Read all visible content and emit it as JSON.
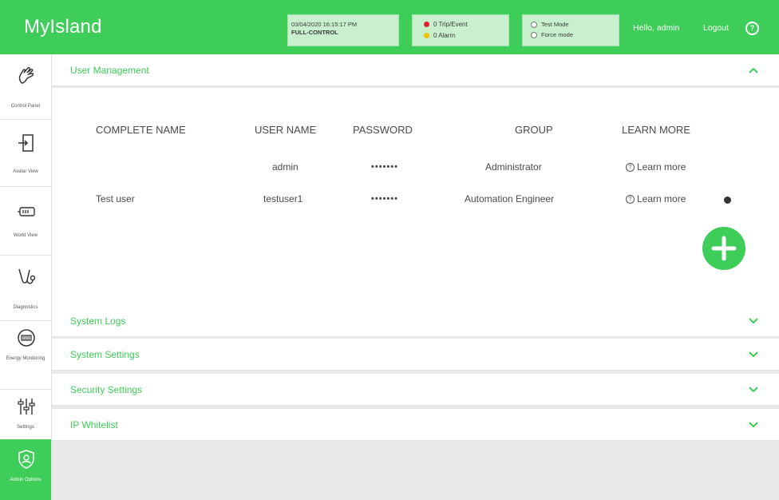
{
  "header": {
    "brand": "MyIsland",
    "datetime": "03/04/2020 16:15:17 PM",
    "control_mode": "FULL-CONTROL",
    "trip_event": "0 Trip/Event",
    "alarm": "0 Alarm",
    "test_mode": "Test Mode",
    "force_mode": "Force mode",
    "greeting": "Hello, admin",
    "logout": "Logout",
    "help_icon": "?"
  },
  "sidebar": {
    "items": [
      {
        "label": "Control Panel",
        "icon": "hand-icon"
      },
      {
        "label": "Avatar View",
        "icon": "enter-door-icon"
      },
      {
        "label": "World View",
        "icon": "device-icon"
      },
      {
        "label": "Diagnostics",
        "icon": "stethoscope-icon"
      },
      {
        "label": "Energy Monitoring",
        "icon": "meter-icon"
      },
      {
        "label": "Settings",
        "icon": "sliders-icon"
      },
      {
        "label": "Admin Options",
        "icon": "shield-user-icon"
      }
    ]
  },
  "user_management": {
    "title": "User Management",
    "columns": [
      "COMPLETE NAME",
      "USER NAME",
      "PASSWORD",
      "GROUP",
      "LEARN MORE"
    ],
    "rows": [
      {
        "complete_name": "",
        "user_name": "admin",
        "password": "•••••••",
        "group": "Administrator",
        "learn_more": "Learn more"
      },
      {
        "complete_name": "Test user",
        "user_name": "testuser1",
        "password": "•••••••",
        "group": "Automation Engineer",
        "learn_more": "Learn more"
      }
    ]
  },
  "sections": [
    {
      "title": "System Logs"
    },
    {
      "title": "System Settings"
    },
    {
      "title": "Security Settings"
    },
    {
      "title": "IP Whitelist"
    }
  ],
  "colors": {
    "brand_green": "#3dcd58",
    "trip_red": "#e0202a",
    "alarm_yellow": "#f2c200"
  }
}
